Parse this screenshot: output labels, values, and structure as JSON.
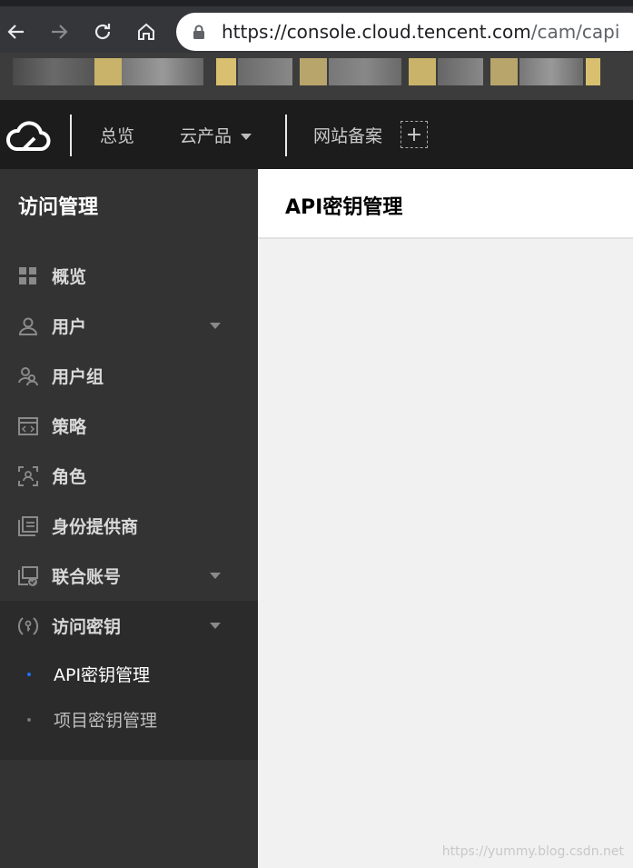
{
  "browser": {
    "url_host": "https://console.cloud.tencent.com",
    "url_path": "/cam/capi"
  },
  "header": {
    "nav": [
      {
        "label": "总览"
      },
      {
        "label": "云产品"
      },
      {
        "label": "网站备案"
      }
    ],
    "add_label": "+"
  },
  "sidebar": {
    "title": "访问管理",
    "items": [
      {
        "label": "概览",
        "icon": "grid-icon"
      },
      {
        "label": "用户",
        "icon": "user-icon"
      },
      {
        "label": "用户组",
        "icon": "user-group-icon"
      },
      {
        "label": "策略",
        "icon": "policy-icon"
      },
      {
        "label": "角色",
        "icon": "role-icon"
      },
      {
        "label": "身份提供商",
        "icon": "identity-provider-icon"
      },
      {
        "label": "联合账号",
        "icon": "federated-account-icon"
      },
      {
        "label": "访问密钥",
        "icon": "access-key-icon"
      }
    ],
    "subitems": [
      {
        "label": "API密钥管理",
        "active": true
      },
      {
        "label": "项目密钥管理",
        "active": false
      }
    ]
  },
  "main": {
    "title": "API密钥管理"
  },
  "watermark": "https://yummy.blog.csdn.net",
  "colors": {
    "active_dot": "#1f6fff",
    "sidebar_bg": "#333333",
    "header_bg": "#1c1c1c"
  }
}
